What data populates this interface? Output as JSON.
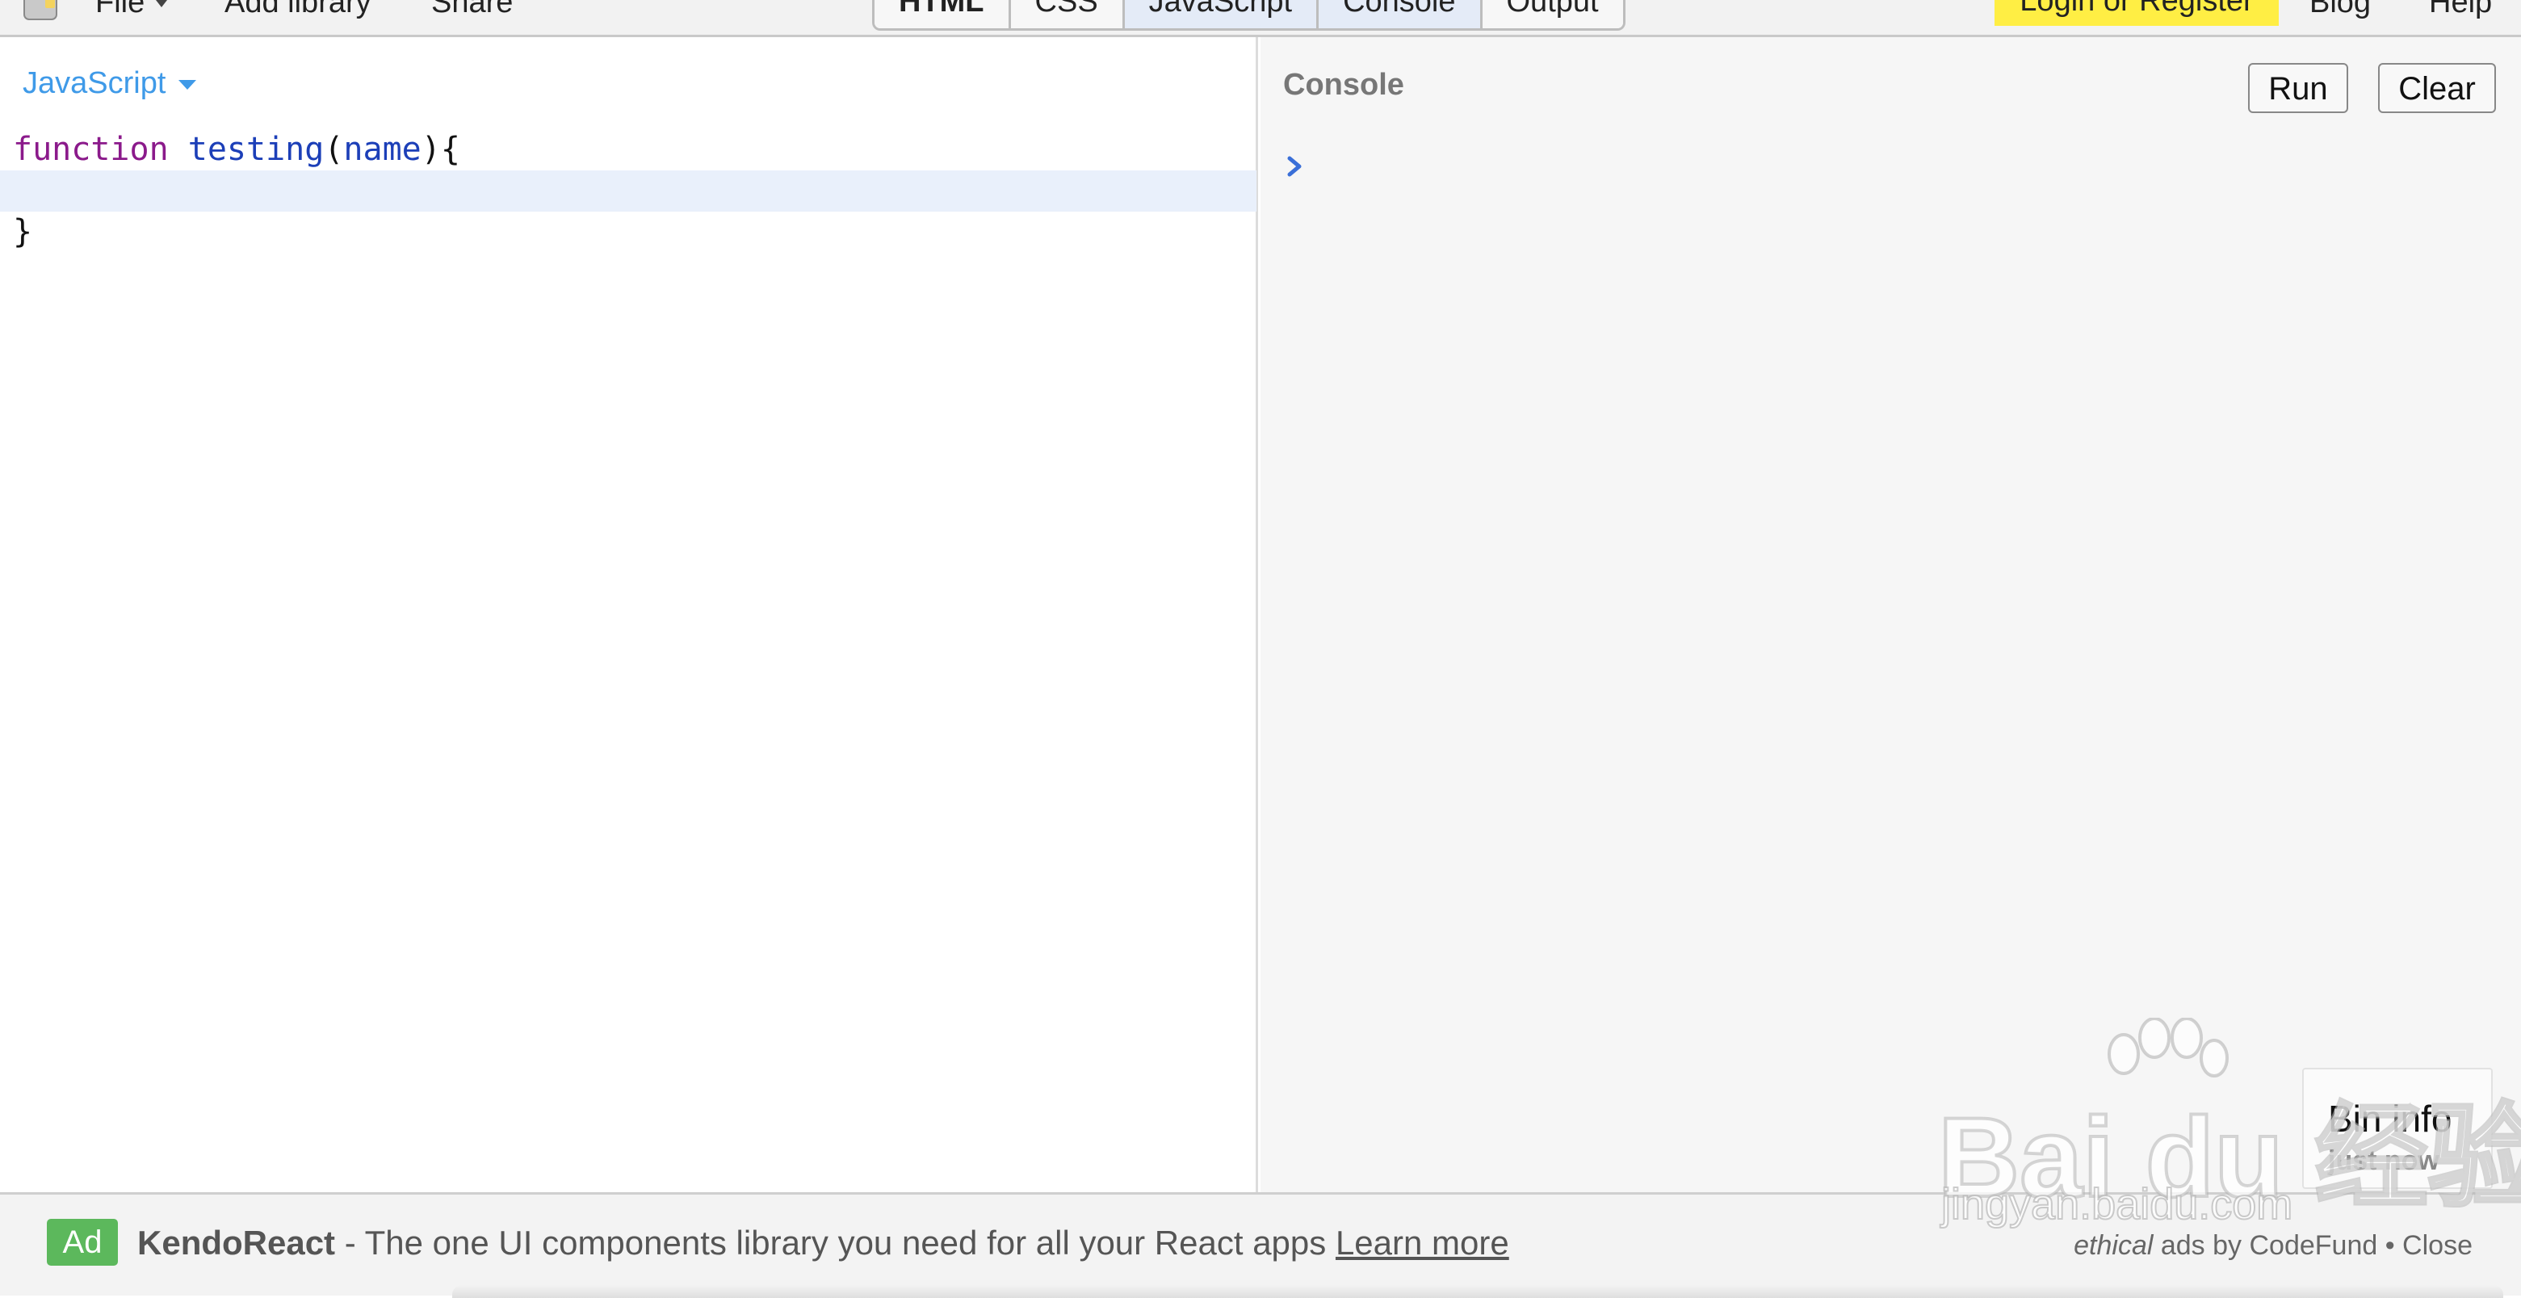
{
  "toolbar": {
    "file_label": "File",
    "add_library_label": "Add library",
    "share_label": "Share",
    "tabs": [
      {
        "label": "HTML",
        "active": false
      },
      {
        "label": "CSS",
        "active": false
      },
      {
        "label": "JavaScript",
        "active": true
      },
      {
        "label": "Console",
        "active": true
      },
      {
        "label": "Output",
        "active": false
      }
    ],
    "login_label": "Login or Register",
    "blog_label": "Blog",
    "help_label": "Help"
  },
  "editor": {
    "language": "JavaScript",
    "code": {
      "line1_keyword": "function",
      "line1_name": "testing",
      "line1_open_paren": "(",
      "line1_param": "name",
      "line1_close": "){",
      "line3": "}"
    }
  },
  "console": {
    "title": "Console",
    "run_label": "Run",
    "clear_label": "Clear",
    "bin_info_title": "Bin info",
    "bin_info_time": "just now"
  },
  "ad": {
    "badge": "Ad",
    "brand": "KendoReact",
    "text": " - The one UI components library you need for all your React apps ",
    "link": "Learn more",
    "credit_italic": "ethical",
    "credit_rest": " ads by CodeFund • Close"
  },
  "watermark": {
    "main": "Bai du 经验",
    "url": "jingyan.baidu.com"
  },
  "colors": {
    "accent_blue": "#3f9ae8",
    "login_yellow": "#ffee44",
    "ad_green": "#5cb85c",
    "keyword_purple": "#8b1a8b",
    "identifier_blue": "#1c3fb8"
  }
}
